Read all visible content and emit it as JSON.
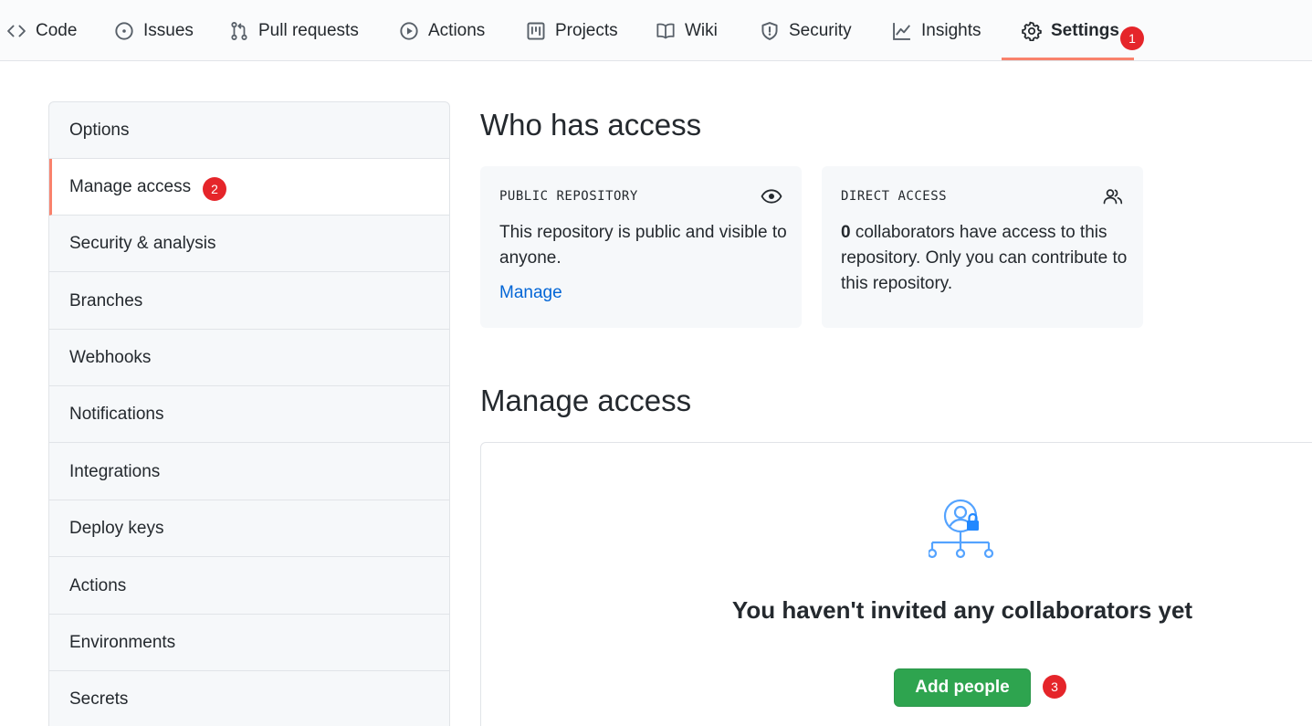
{
  "topnav": {
    "tabs": [
      {
        "label": "Code",
        "icon": "code-icon"
      },
      {
        "label": "Issues",
        "icon": "issue-opened-icon"
      },
      {
        "label": "Pull requests",
        "icon": "git-pull-request-icon"
      },
      {
        "label": "Actions",
        "icon": "play-icon"
      },
      {
        "label": "Projects",
        "icon": "project-icon"
      },
      {
        "label": "Wiki",
        "icon": "book-icon"
      },
      {
        "label": "Security",
        "icon": "shield-icon"
      },
      {
        "label": "Insights",
        "icon": "graph-icon"
      },
      {
        "label": "Settings",
        "icon": "gear-icon",
        "selected": true
      }
    ]
  },
  "annotations": {
    "badge1": "1",
    "badge2": "2",
    "badge3": "3",
    "color": "#e5252a"
  },
  "sidebar": {
    "items": [
      {
        "label": "Options"
      },
      {
        "label": "Manage access",
        "active": true
      },
      {
        "label": "Security & analysis"
      },
      {
        "label": "Branches"
      },
      {
        "label": "Webhooks"
      },
      {
        "label": "Notifications"
      },
      {
        "label": "Integrations"
      },
      {
        "label": "Deploy keys"
      },
      {
        "label": "Actions"
      },
      {
        "label": "Environments"
      },
      {
        "label": "Secrets"
      }
    ]
  },
  "who_has_access": {
    "heading": "Who has access",
    "public_card": {
      "label": "PUBLIC REPOSITORY",
      "icon": "eye-icon",
      "body": "This repository is public and visible to anyone.",
      "link": "Manage"
    },
    "direct_card": {
      "label": "DIRECT ACCESS",
      "icon": "people-icon",
      "count": "0",
      "body": " collaborators have access to this repository. Only you can contribute to this repository."
    }
  },
  "manage_access": {
    "heading": "Manage access",
    "illustration_icon": "person-lock-network-icon",
    "empty_title": "You haven't invited any collaborators yet",
    "add_button": "Add people"
  },
  "colors": {
    "accent_underline": "#f9826c",
    "link": "#0366d6",
    "button_green": "#2ea44f",
    "illustration_blue": "#54a3ff"
  }
}
